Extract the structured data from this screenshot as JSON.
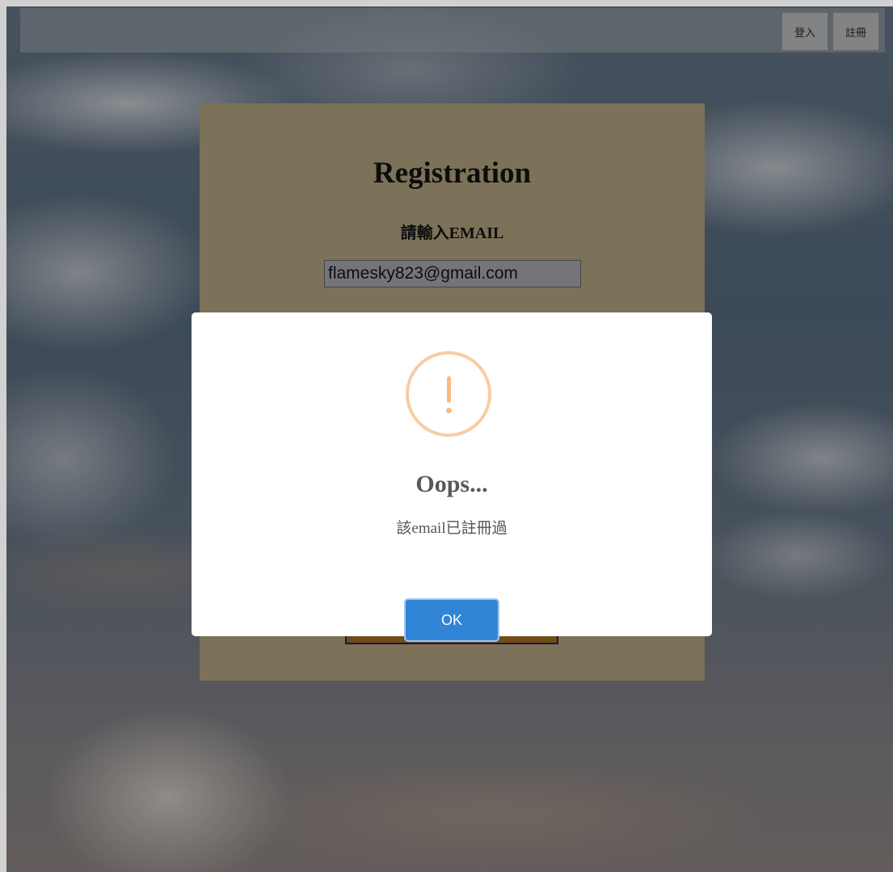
{
  "header": {
    "login_label": "登入",
    "register_label": "註冊"
  },
  "registration": {
    "title": "Registration",
    "email_label": "請輸入EMAIL",
    "email_value": "flamesky823@gmail.com"
  },
  "alert": {
    "icon": "exclamation-warning-icon",
    "title": "Oops...",
    "message": "該email已註冊過",
    "ok_label": "OK",
    "colors": {
      "icon": "#f8bb86",
      "button": "#3085d6"
    }
  }
}
